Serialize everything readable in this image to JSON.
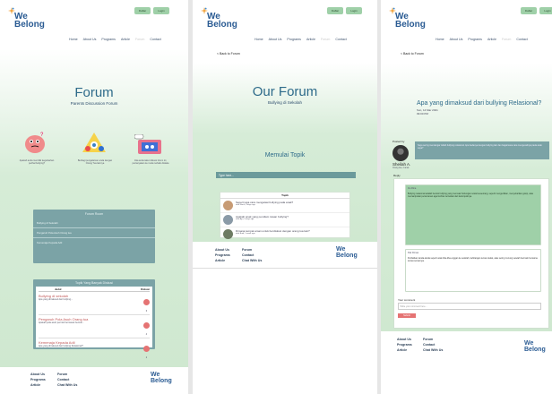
{
  "brand": {
    "logo_text_1": "We",
    "logo_text_2": "Belong",
    "tm": "™"
  },
  "top_buttons": [
    "Daftar",
    "Login"
  ],
  "nav": [
    "Home",
    "About Us",
    "Programs",
    "Article",
    "Forum",
    "Contact"
  ],
  "page1": {
    "title": "Forum",
    "subtitle": "Parents Discussion Forum",
    "monsters": [
      {
        "caption": "Apakah anda memiliki kegelisahan perihal bullying?",
        "color": "#f08b8b"
      },
      {
        "caption": "Berbagi pengalaman anda dengan Orang Tua lainnya",
        "color": "#f6d34a"
      },
      {
        "caption": "Jika anda takut diskusi forum ini, pertanyakan ke mode terbaik diskala",
        "color": "#e8728c"
      }
    ],
    "forum_room": {
      "title": "Forum Room",
      "items": [
        "Bullying di Sekolah",
        "Pengaruh Pola Asuh Orang tua",
        "Kemenaja Kepada Adil"
      ]
    },
    "popular": {
      "title": "Topik Yang Banyak Diskusi",
      "col1": "Judul",
      "col2": "Diskusi",
      "items": [
        {
          "title": "Bullying di sekolah",
          "meta": "Apa yang dimaksud dari bullying...",
          "count": "6"
        },
        {
          "title": "Pengaruh Pola Asuh Orang tua",
          "meta": "Apakah pola asuh permisif termasuk bentuk...",
          "count": "4"
        },
        {
          "title": "Kemenaja Kepada Adil",
          "meta": "Apa yang dimaksud dari bullying Relasional?",
          "count": "2"
        }
      ]
    }
  },
  "footer": {
    "col1": [
      "About Us",
      "Programs",
      "Article"
    ],
    "col2": [
      "Forum",
      "Contact",
      "Chat With Us"
    ]
  },
  "page2": {
    "back": "< Back to Forum",
    "title": "Our Forum",
    "subtitle": "Bullying di Sekolah",
    "start_topic": "Memulai Topik",
    "input_placeholder": "Type here...",
    "list_header": "Topik",
    "topics": [
      {
        "title": "Seperti apa cara mengatasi bullying pada anak?",
        "meta": "oleh Nurul, 3 days ago"
      },
      {
        "title": "Apakah anak yang pendiam rawan bullying?",
        "meta": "oleh Ayu, 5 days ago"
      },
      {
        "title": "Dimana tempat aman untuk berdiskusi dengan orang tua lain?",
        "meta": "oleh Budi, 1 week ago"
      }
    ]
  },
  "page3": {
    "back": "< Back to Forum",
    "title": "Apa yang dimaksud dari bullying Relasional?",
    "date": "Sun, 14 Mar 2021",
    "time": "09:00 PM",
    "posted_by": "Posted by",
    "author": "Sheilah A.",
    "author_meta": "Orang tua, 2 anak",
    "question": "Saya sering mendengar istilah bullying relasional. Apa bedanya dengan bullying lain dan bagaimana cara mengenalinya pada anak saya?",
    "reply_label": "Reply",
    "replies": [
      {
        "name": "Ibu Rina",
        "text": "Bullying relasional adalah bentuk bullying yang merusak hubungan sosial seseorang, seperti mengucilkan, menyebarkan gosip, atau memanipulasi pertemanan agar korban terisolasi dari kelompoknya."
      },
      {
        "name": "Pak Dimas",
        "text": "Perhatikan tanda-tanda seperti anak tiba-tiba enggan ke sekolah, kehilangan teman dekat, atau sering murung setelah bermain bersama teman-temannya."
      }
    ],
    "comment_label": "Your comment",
    "comment_placeholder": "Write your comment here...",
    "submit": "Submit"
  },
  "colors": {
    "accent": "#2e6b8a",
    "green": "#cfe8d0",
    "card": "#7ba3a6",
    "button": "#e57373"
  }
}
